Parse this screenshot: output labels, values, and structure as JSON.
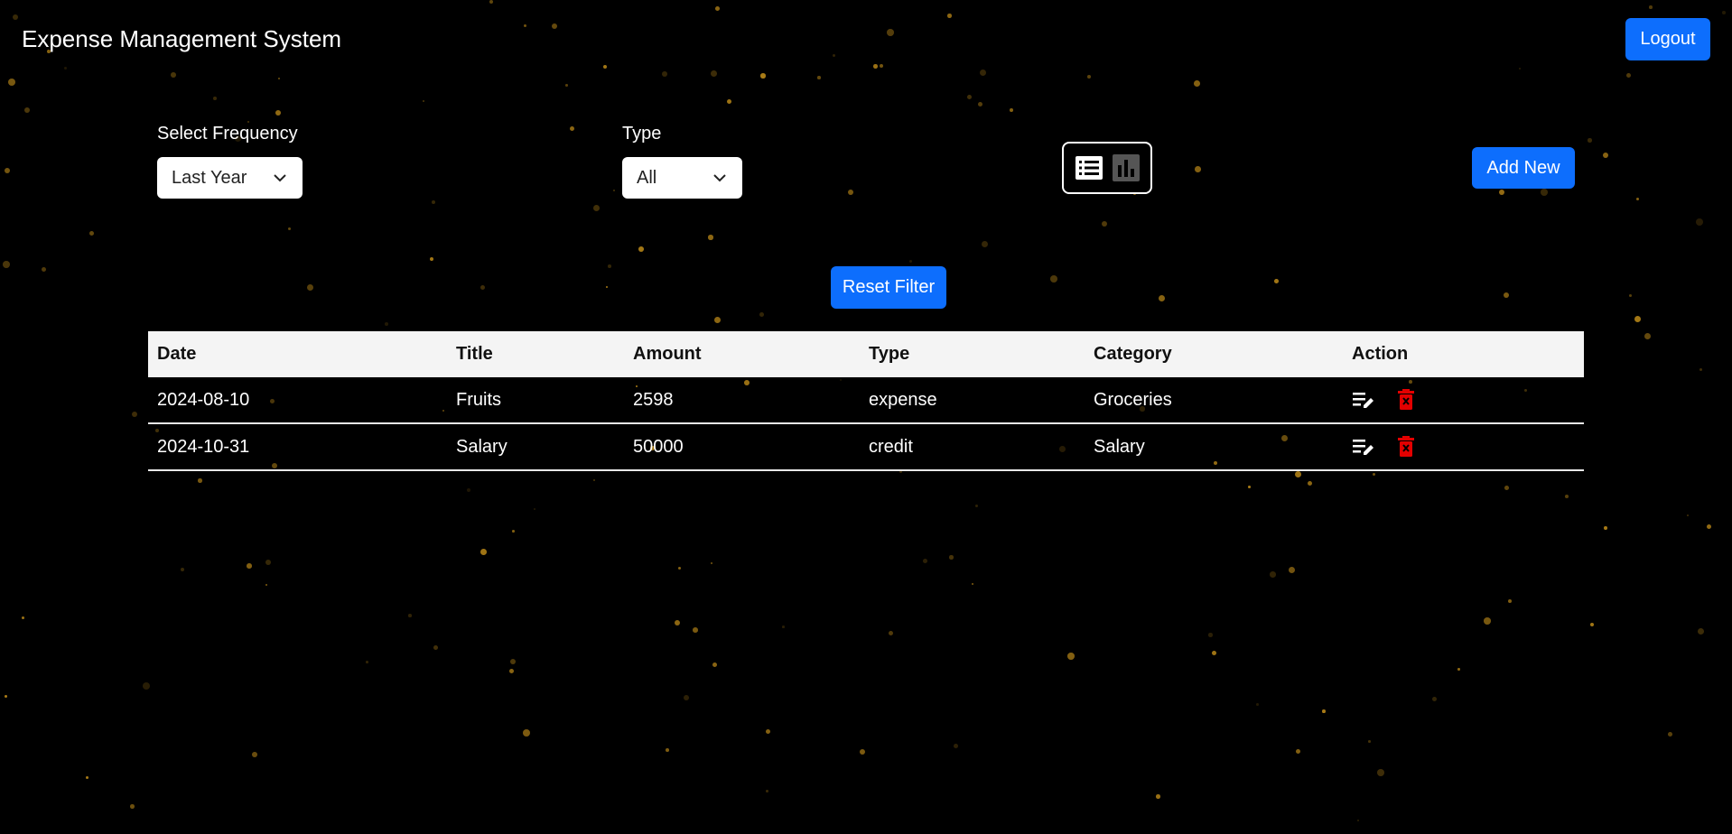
{
  "header": {
    "title": "Expense Management System",
    "logout_label": "Logout"
  },
  "filters": {
    "frequency_label": "Select Frequency",
    "frequency_value": "Last Year",
    "type_label": "Type",
    "type_value": "All"
  },
  "view_toggle": {
    "list_icon": "list-icon",
    "chart_icon": "bar-chart-icon",
    "active": "list"
  },
  "buttons": {
    "add_new": "Add New",
    "reset_filter": "Reset Filter"
  },
  "table": {
    "headers": [
      "Date",
      "Title",
      "Amount",
      "Type",
      "Category",
      "Action"
    ],
    "rows": [
      [
        "2024-08-10",
        "Fruits",
        "2598",
        "expense",
        "Groceries"
      ],
      [
        "2024-10-31",
        "Salary",
        "50000",
        "credit",
        "Salary"
      ]
    ],
    "action_icons": [
      "edit-icon",
      "delete-icon"
    ]
  },
  "colors": {
    "primary": "#0d6efd",
    "background": "#000000",
    "delete": "#e30000",
    "star": "#c8921a"
  }
}
